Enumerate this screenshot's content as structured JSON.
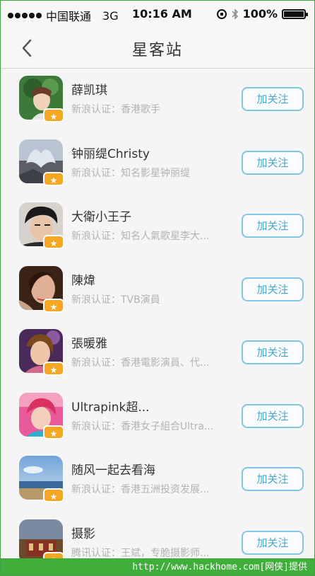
{
  "status_bar": {
    "carrier": "中国联通",
    "network": "3G",
    "time": "10:16 AM",
    "battery": "100%"
  },
  "nav": {
    "title": "星客站"
  },
  "follow_label": "加关注",
  "rows": [
    {
      "name": "薛凯琪",
      "desc": "新浪认证：香港歌手"
    },
    {
      "name": "钟丽缇Christy",
      "desc": "新浪认证：知名影星钟丽缇"
    },
    {
      "name": "大衛小王子",
      "desc": "新浪认证：知名人氣歌星李大..."
    },
    {
      "name": "陳煒",
      "desc": "新浪认证：TVB演員"
    },
    {
      "name": "張暖雅",
      "desc": "新浪认证：香港電影演員、代..."
    },
    {
      "name": "Ultrapink超...",
      "desc": "新浪认证：香港女子組合Ultra..."
    },
    {
      "name": "随风一起去看海",
      "desc": "新浪认证：香港五洲投资发展..."
    },
    {
      "name": "摄影",
      "desc": "腾讯认证：王斌，专脆摄影师..."
    }
  ],
  "watermark": "http://www.hackhome.com[网侠]提供",
  "colors": {
    "accent": "#4aa6c9",
    "badge": "#f5a623",
    "watermark_bg": "#3fae3a"
  }
}
